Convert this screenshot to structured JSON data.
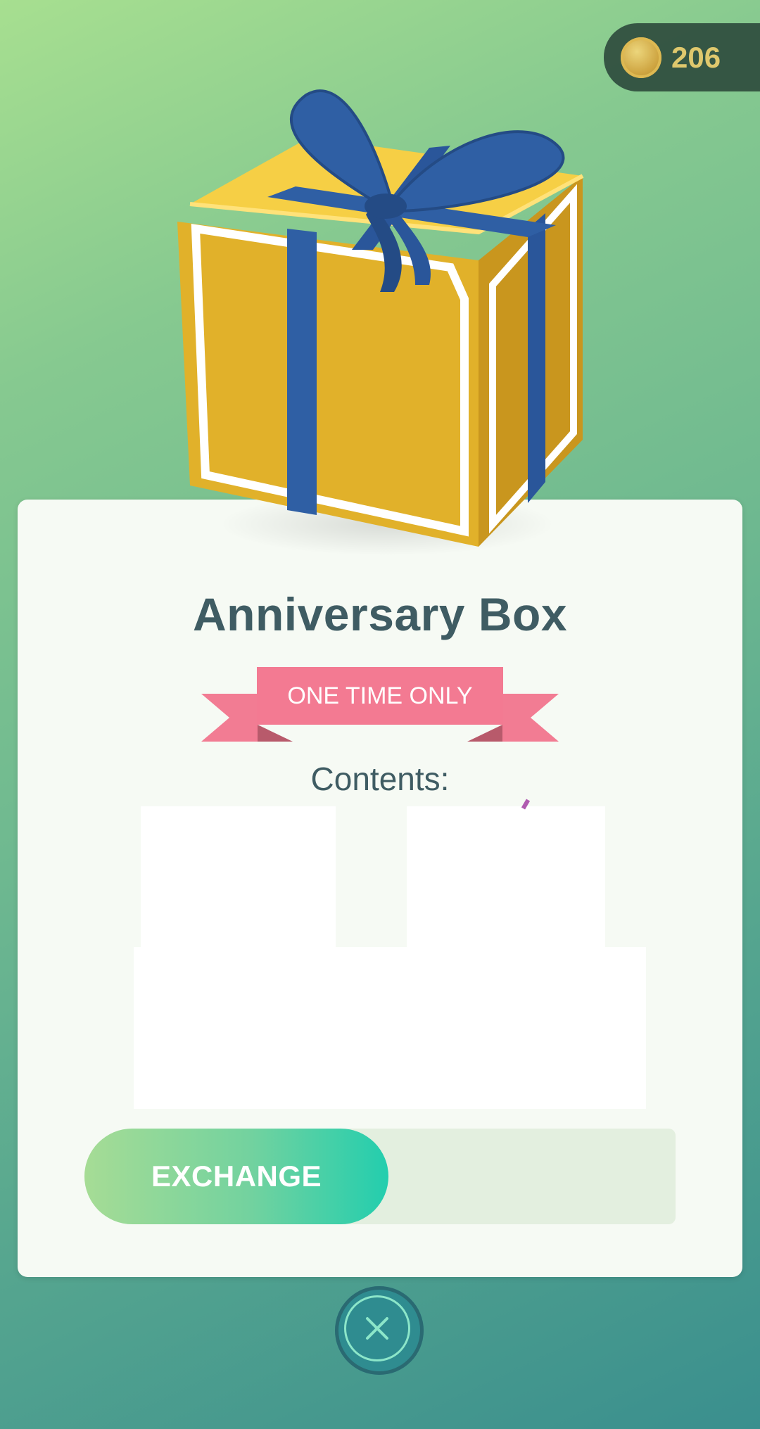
{
  "header": {
    "coin_count": "206",
    "coin_icon": "pokecoin-icon"
  },
  "item": {
    "title": "Anniversary Box",
    "ribbon_text": "ONE TIME ONLY",
    "contents_label": "Contents:",
    "image_icon": "gift-box-icon"
  },
  "actions": {
    "exchange_label": "EXCHANGE",
    "close_icon": "close-icon"
  },
  "colors": {
    "title": "#3f5c63",
    "ribbon": "#f27c93",
    "gift_box": "#e1b12a",
    "ribbon_bow": "#2f5fa4",
    "exchange_gradient_start": "#a6dc95",
    "exchange_gradient_end": "#23ceae",
    "close_button": "#2f8c90"
  }
}
